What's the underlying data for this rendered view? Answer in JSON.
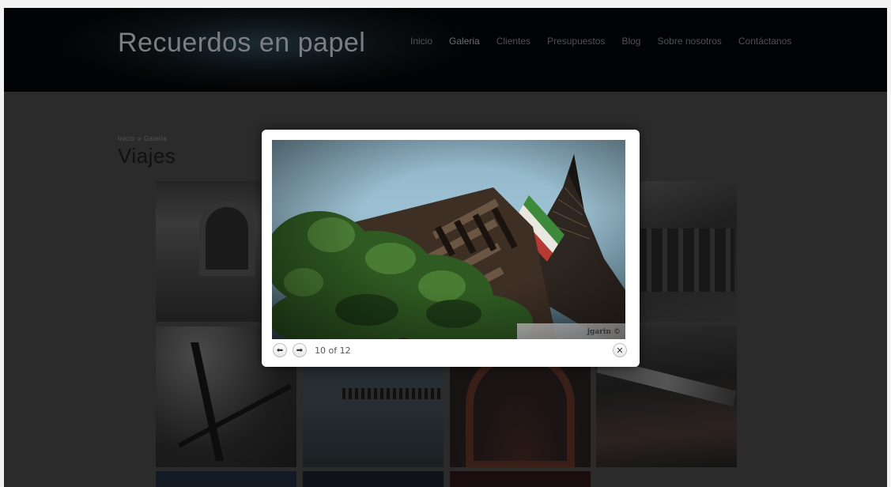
{
  "site": {
    "logo": "Recuerdos en papel"
  },
  "nav": {
    "items": [
      {
        "label": "Inicio"
      },
      {
        "label": "Galeria"
      },
      {
        "label": "Clientes"
      },
      {
        "label": "Presupuestos"
      },
      {
        "label": "Blog"
      },
      {
        "label": "Sobre nosotros"
      },
      {
        "label": "Contáctanos"
      }
    ]
  },
  "page": {
    "breadcrumb": "Inicio > Galeria",
    "title": "Viajes"
  },
  "lightbox": {
    "counter": "10 of 12",
    "watermark": "jgarin ©",
    "prev_icon": "left-arrow-icon",
    "next_icon": "right-arrow-icon",
    "close_icon": "close-icon"
  },
  "colors": {
    "header_bg": "#020304",
    "page_bg": "#2b2b2b",
    "nav_text": "#4d5254",
    "logo_text": "#7b7f82"
  }
}
